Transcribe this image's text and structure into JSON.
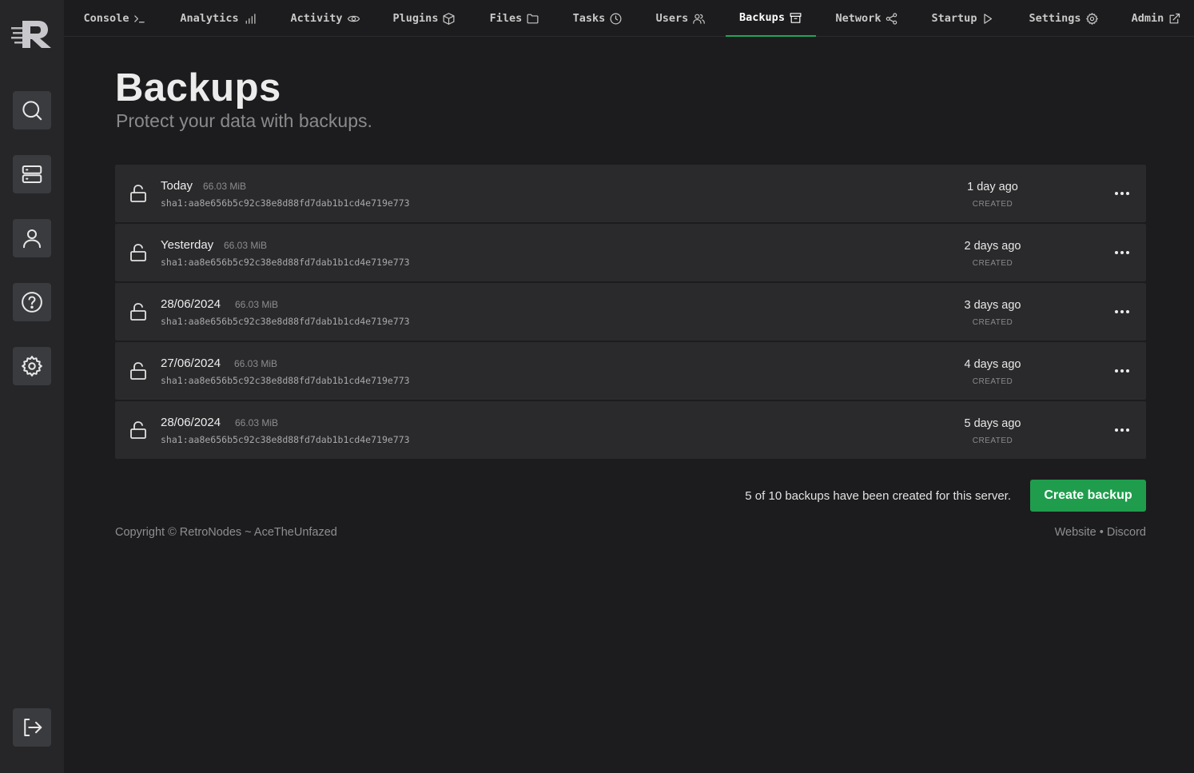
{
  "nav": {
    "tabs": [
      {
        "label": "Console",
        "icon": "terminal-icon"
      },
      {
        "label": "Analytics",
        "icon": "bar-chart-icon"
      },
      {
        "label": "Activity",
        "icon": "eye-icon"
      },
      {
        "label": "Plugins",
        "icon": "package-icon"
      },
      {
        "label": "Files",
        "icon": "folder-icon"
      },
      {
        "label": "Tasks",
        "icon": "clock-icon"
      },
      {
        "label": "Users",
        "icon": "users-icon"
      },
      {
        "label": "Backups",
        "icon": "archive-icon",
        "active": true
      },
      {
        "label": "Network",
        "icon": "share-icon"
      },
      {
        "label": "Startup",
        "icon": "play-icon"
      },
      {
        "label": "Settings",
        "icon": "gear-icon"
      },
      {
        "label": "Admin",
        "icon": "external-link-icon"
      }
    ]
  },
  "sidebar": {
    "buttons": [
      "search-icon",
      "server-icon",
      "user-icon",
      "help-icon",
      "settings-icon"
    ],
    "logout": "logout-icon"
  },
  "page": {
    "title": "Backups",
    "subtitle": "Protect your data with backups."
  },
  "backups": [
    {
      "name": "Today",
      "size": "66.03 MiB",
      "hash": "sha1:aa8e656b5c92c38e8d88fd7dab1b1cd4e719e773",
      "when": "1 day ago",
      "created": "CREATED"
    },
    {
      "name": "Yesterday",
      "size": "66.03 MiB",
      "hash": "sha1:aa8e656b5c92c38e8d88fd7dab1b1cd4e719e773",
      "when": "2 days ago",
      "created": "CREATED"
    },
    {
      "name": "28/06/2024",
      "size": "66.03 MiB",
      "hash": "sha1:aa8e656b5c92c38e8d88fd7dab1b1cd4e719e773",
      "when": "3 days ago",
      "created": "CREATED"
    },
    {
      "name": "27/06/2024",
      "size": "66.03 MiB",
      "hash": "sha1:aa8e656b5c92c38e8d88fd7dab1b1cd4e719e773",
      "when": "4 days ago",
      "created": "CREATED"
    },
    {
      "name": "28/06/2024",
      "size": "66.03 MiB",
      "hash": "sha1:aa8e656b5c92c38e8d88fd7dab1b1cd4e719e773",
      "when": "5 days ago",
      "created": "CREATED"
    }
  ],
  "summary": "5 of 10 backups have been created for this server.",
  "create_button": "Create backup",
  "footer": {
    "copyright": "Copyright © RetroNodes ~ AceTheUnfazed",
    "website": "Website",
    "separator": "•",
    "discord": "Discord"
  },
  "colors": {
    "accent": "#22a35a",
    "button": "#1f9d4d",
    "background": "#1c1c1e",
    "sidebar": "#262628",
    "row": "#2a2a2c"
  }
}
